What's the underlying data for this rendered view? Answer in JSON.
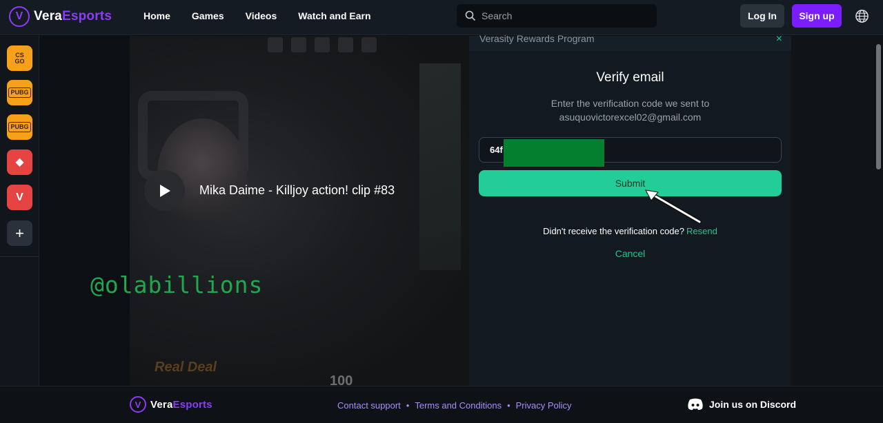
{
  "brand": {
    "name_part1": "Vera",
    "name_part2": "Esports",
    "mark": "V"
  },
  "nav": {
    "items": [
      "Home",
      "Games",
      "Videos",
      "Watch and Earn"
    ]
  },
  "search": {
    "placeholder": "Search"
  },
  "auth": {
    "login": "Log In",
    "signup": "Sign up"
  },
  "sidebar": {
    "games": [
      {
        "name": "CS GO",
        "label": "CS\nGO"
      },
      {
        "name": "PUBG",
        "label": "PUBG"
      },
      {
        "name": "PUBG Mobile",
        "label": "PUBG"
      },
      {
        "name": "Dota 2",
        "label": "◆"
      },
      {
        "name": "Valorant",
        "label": "V"
      }
    ],
    "add_label": "+"
  },
  "video": {
    "title": "Mika Daime - Killjoy action! clip #83",
    "hud_stat": "100",
    "brand_overlay": "Real Deal"
  },
  "watermark": "@olabillions",
  "modal": {
    "header": "Verasity Rewards Program",
    "close": "×",
    "title": "Verify email",
    "description_line1": "Enter the verification code we sent to",
    "description_line2": "asuquovictorexcel02@gmail.com",
    "code_prefix": "64f",
    "submit": "Submit",
    "resend_prompt": "Didn't receive the verification code?",
    "resend_link": "Resend",
    "cancel": "Cancel"
  },
  "footer": {
    "links": [
      "Contact support",
      "Terms and Conditions",
      "Privacy Policy"
    ],
    "discord": "Join us on Discord"
  },
  "colors": {
    "accent_purple": "#7a1dff",
    "accent_green": "#22cd97",
    "link_purple": "#a98cff",
    "redaction": "#047f2f"
  }
}
